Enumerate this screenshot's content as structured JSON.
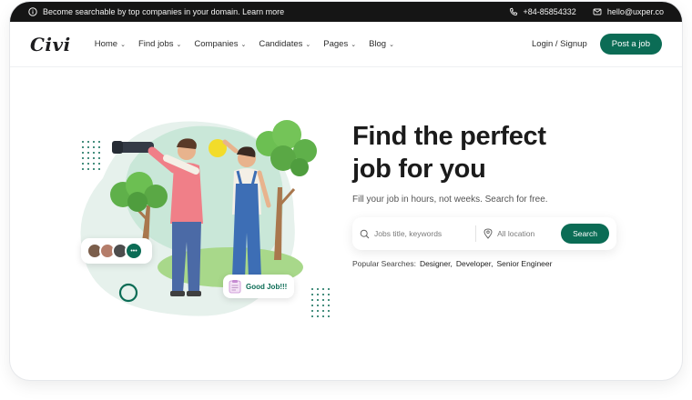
{
  "topbar": {
    "announcement": "Become searchable by top companies in your domain. Learn more",
    "phone": "+84-85854332",
    "email": "hello@uxper.co"
  },
  "nav": {
    "logo": "Civi",
    "menu": [
      {
        "label": "Home"
      },
      {
        "label": "Find jobs"
      },
      {
        "label": "Companies"
      },
      {
        "label": "Candidates"
      },
      {
        "label": "Pages"
      },
      {
        "label": "Blog"
      }
    ],
    "login": "Login / Signup",
    "post_job": "Post a job"
  },
  "hero": {
    "headline_line1": "Find the perfect",
    "headline_line2": "job for you",
    "subtitle": "Fill your job in hours, not weeks. Search for free.",
    "search": {
      "keywords_placeholder": "Jobs title, keywords",
      "location_placeholder": "All location",
      "button": "Search"
    },
    "popular_label": "Popular Searches:",
    "popular": [
      "Designer,",
      "Developer,",
      "Senior Engineer"
    ],
    "badge": "Good Job!!!",
    "avatar_more": "•••"
  },
  "colors": {
    "brand": "#0b6c55",
    "topbar": "#151515",
    "blob": "#e6f1ec"
  }
}
